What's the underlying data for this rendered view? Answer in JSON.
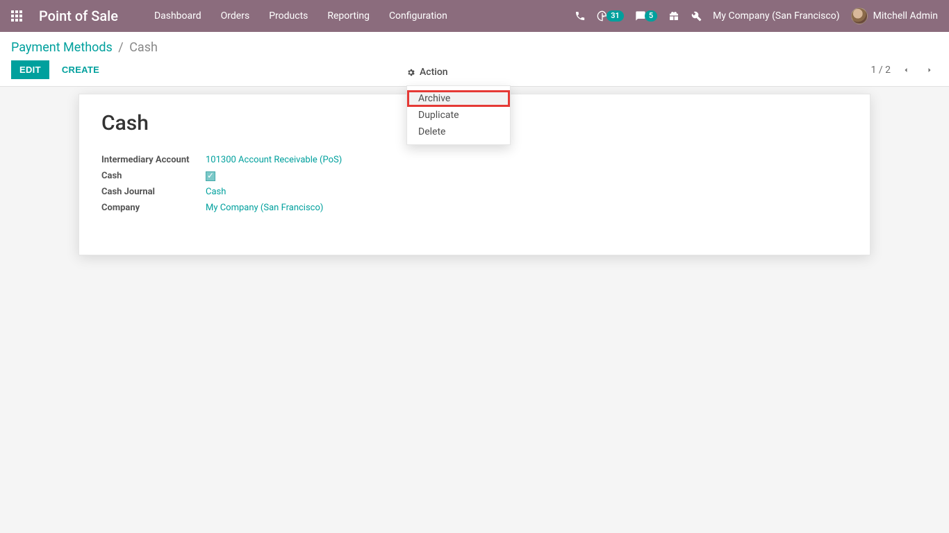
{
  "header": {
    "brand": "Point of Sale",
    "nav": [
      "Dashboard",
      "Orders",
      "Products",
      "Reporting",
      "Configuration"
    ],
    "badges": {
      "activity": "31",
      "messages": "5"
    },
    "company": "My Company (San Francisco)",
    "user": "Mitchell Admin"
  },
  "breadcrumb": {
    "parent": "Payment Methods",
    "current": "Cash"
  },
  "buttons": {
    "edit": "EDIT",
    "create": "CREATE"
  },
  "action": {
    "label": "Action",
    "items": [
      "Archive",
      "Duplicate",
      "Delete"
    ]
  },
  "pager": {
    "text": "1 / 2"
  },
  "record": {
    "title": "Cash",
    "fields": {
      "intermediary_account": {
        "label": "Intermediary Account",
        "value": "101300 Account Receivable (PoS)"
      },
      "cash": {
        "label": "Cash",
        "checked": true
      },
      "cash_journal": {
        "label": "Cash Journal",
        "value": "Cash"
      },
      "company": {
        "label": "Company",
        "value": "My Company (San Francisco)"
      }
    }
  }
}
